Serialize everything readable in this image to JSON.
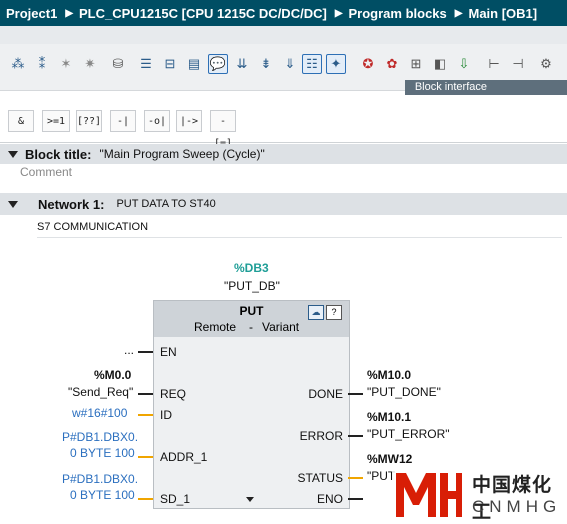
{
  "titlebar": {
    "crumbs": [
      "Project1",
      "PLC_CPU1215C [CPU 1215C DC/DC/DC]",
      "Program blocks",
      "Main [OB1]"
    ]
  },
  "block_interface_label": "Block interface",
  "ladder_toolbar": [
    "&",
    ">=1",
    "[??]",
    "-|",
    "-o|",
    "|->",
    "-[=]"
  ],
  "block": {
    "title_label": "Block title:",
    "title_value": "\"Main Program Sweep (Cycle)\"",
    "comment_placeholder": "Comment"
  },
  "network": {
    "label": "Network 1:",
    "title": "PUT DATA TO ST40",
    "comment": "S7 COMMUNICATION"
  },
  "fb": {
    "db_address": "%DB3",
    "db_name": "\"PUT_DB\"",
    "name": "PUT",
    "remote": "Remote",
    "dash": "-",
    "variant": "Variant",
    "inputs": {
      "en": "EN",
      "req": "REQ",
      "id": "ID",
      "addr_1": "ADDR_1",
      "sd_1": "SD_1"
    },
    "outputs": {
      "done": "DONE",
      "error": "ERROR",
      "status": "STATUS",
      "eno": "ENO"
    },
    "operands": {
      "en": "...",
      "req_addr": "%M0.0",
      "req_name": "\"Send_Req\"",
      "id": "w#16#100",
      "addr_1_line1": "P#DB1.DBX0.",
      "addr_1_line2": "0 BYTE 100",
      "sd_1_line1": "P#DB1.DBX0.",
      "sd_1_line2": "0 BYTE 100",
      "done_addr": "%M10.0",
      "done_name": "\"PUT_DONE\"",
      "error_addr": "%M10.1",
      "error_name": "\"PUT_ERROR\"",
      "status_addr": "%MW12",
      "status_name": "\"PUT"
    }
  },
  "watermark": {
    "cn": "中国煤化工",
    "en": "CNMHG"
  }
}
